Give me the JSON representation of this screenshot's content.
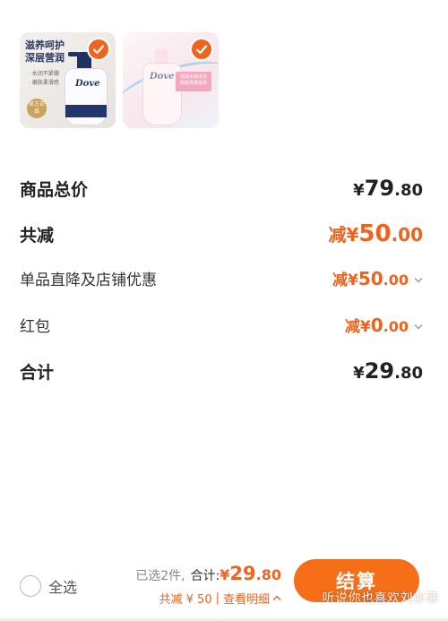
{
  "products": [
    {
      "name": "Dove body wash (deep nourishing)",
      "promo_lines": [
        "滋养呵护",
        "深层营润"
      ],
      "sub_lines": [
        "· 水润不紧绷",
        "· 嫩肤柔滑感"
      ],
      "badge": "官方正品",
      "brand": "Dove",
      "selected": true
    },
    {
      "name": "Dove body wash (peach)",
      "brand": "Dove",
      "tag_lines": [
        "清润水感沐浴",
        "桃桃果香滋润"
      ],
      "selected": true
    }
  ],
  "price_breakdown": {
    "subtotal": {
      "label": "商品总价",
      "currency": "¥",
      "integer": "79",
      "decimal": ".80"
    },
    "discount_total": {
      "label": "共减",
      "prefix": "减¥",
      "integer": "50",
      "decimal": ".00"
    },
    "store_discount": {
      "label": "单品直降及店铺优惠",
      "prefix": "减¥",
      "integer": "50",
      "decimal": ".00"
    },
    "red_packet": {
      "label": "红包",
      "prefix": "减¥",
      "integer": "0",
      "decimal": ".00"
    },
    "total": {
      "label": "合计",
      "currency": "¥",
      "integer": "29",
      "decimal": ".80"
    }
  },
  "bottom_bar": {
    "select_all_label": "全选",
    "selected_count": "已选2件,",
    "total_label": "合计:",
    "total_currency": "¥",
    "total_integer": "29",
    "total_decimal": ".80",
    "discount_text": "共减 ¥ 50",
    "separator": "|",
    "details_link": "查看明细",
    "checkout_label": "结算",
    "watermark": "听说你也喜欢刘亦菲"
  },
  "colors": {
    "accent": "#f0631f",
    "checkout_button": "#f66e18",
    "text": "#222222"
  }
}
